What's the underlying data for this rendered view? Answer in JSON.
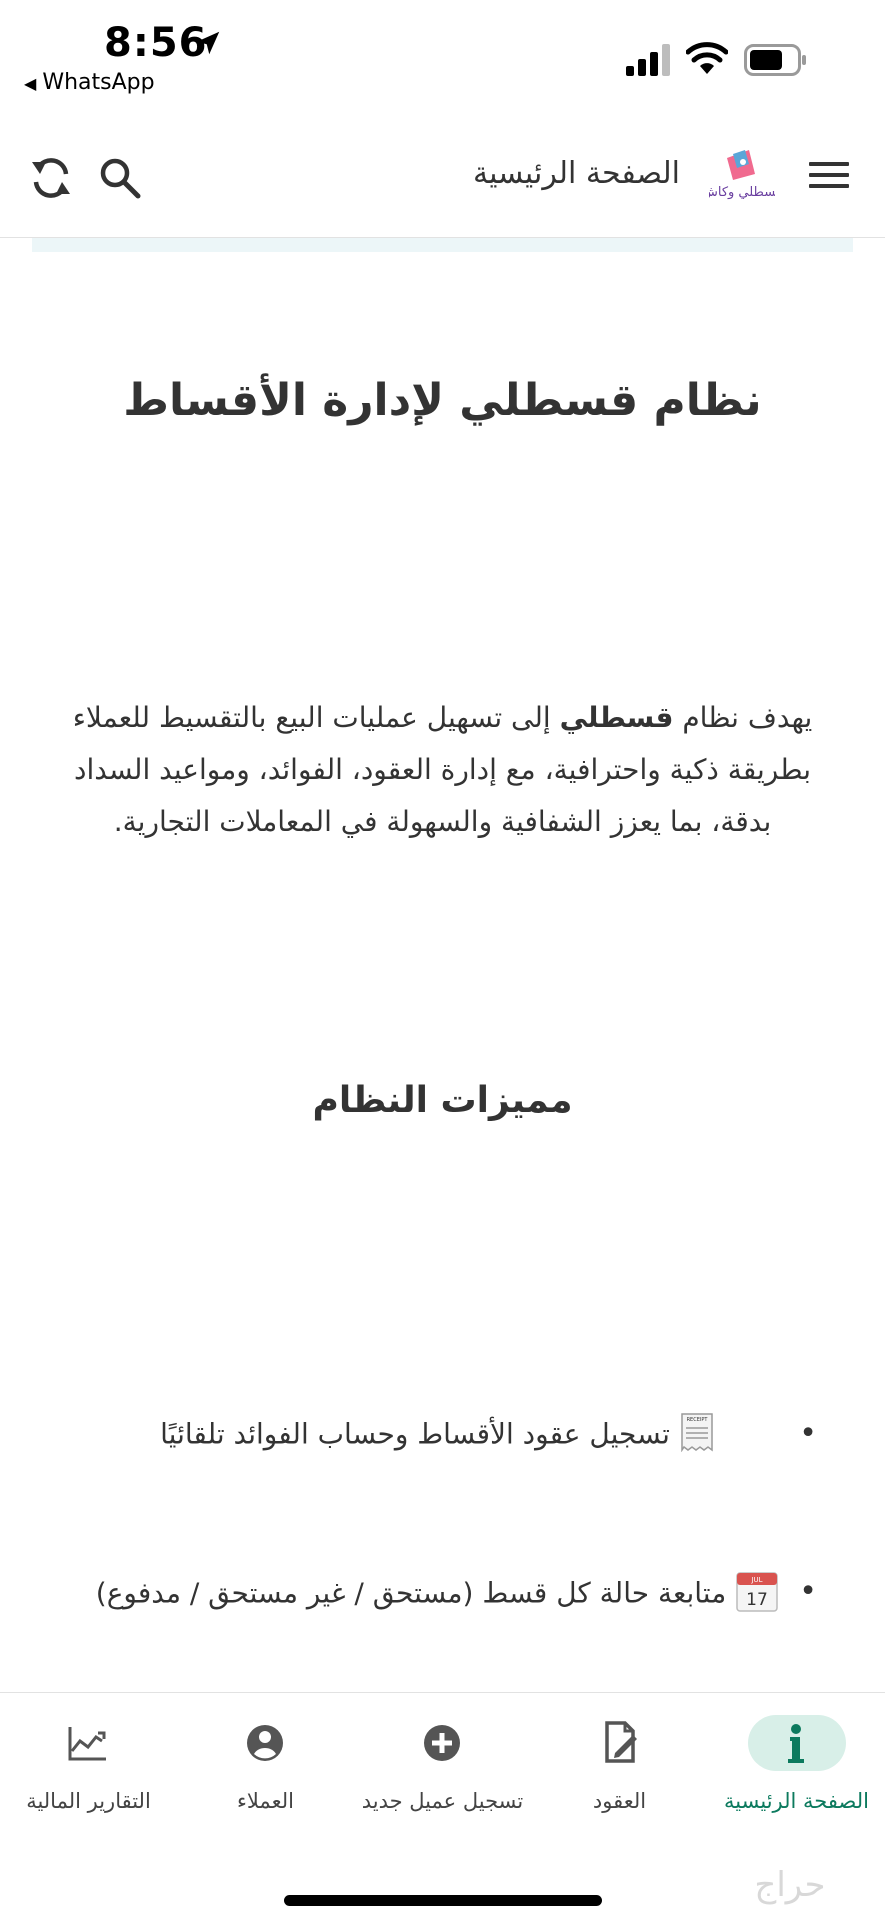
{
  "status_bar": {
    "time": "8:56",
    "back_label": "WhatsApp",
    "back_glyph": "◀"
  },
  "app_bar": {
    "title": "الصفحة الرئيسية",
    "logo_text": "قسطلي وكاش"
  },
  "content": {
    "hero_title": "نظام قسطلي لإدارة الأقساط",
    "intro_before": "يهدف نظام ",
    "intro_bold": "قسطلي",
    "intro_after": " إلى تسهيل عمليات البيع بالتقسيط للعملاء بطريقة ذكية واحترافية، مع إدارة العقود، الفوائد، ومواعيد السداد بدقة، بما يعزز الشفافية والسهولة في المعاملات التجارية.",
    "features_title": "مميزات النظام",
    "features": [
      {
        "text": "تسجيل عقود الأقساط وحساب الفوائد تلقائيًا",
        "icon": "receipt-icon",
        "icon_label": "RECEIPT"
      },
      {
        "text": "متابعة حالة كل قسط (مستحق / غير مستحق / مدفوع)",
        "icon": "calendar-icon",
        "icon_month": "JUL",
        "icon_day": "17"
      }
    ],
    "bullet": "•"
  },
  "bottom_nav": {
    "items": [
      {
        "label": "الصفحة الرئيسية",
        "icon": "info-icon",
        "active": true
      },
      {
        "label": "العقود",
        "icon": "contract-edit-icon",
        "active": false
      },
      {
        "label": "تسجيل عميل جديد",
        "icon": "add-circle-icon",
        "active": false
      },
      {
        "label": "العملاء",
        "icon": "account-circle-icon",
        "active": false
      },
      {
        "label": "التقارير المالية",
        "icon": "chart-icon",
        "active": false
      }
    ]
  },
  "watermark_text": "حراج",
  "colors": {
    "accent": "#0c7a5e",
    "active_pill": "#d8efe8",
    "text": "#333333",
    "icon_gray": "#555555",
    "strip": "#ecf6f8"
  }
}
